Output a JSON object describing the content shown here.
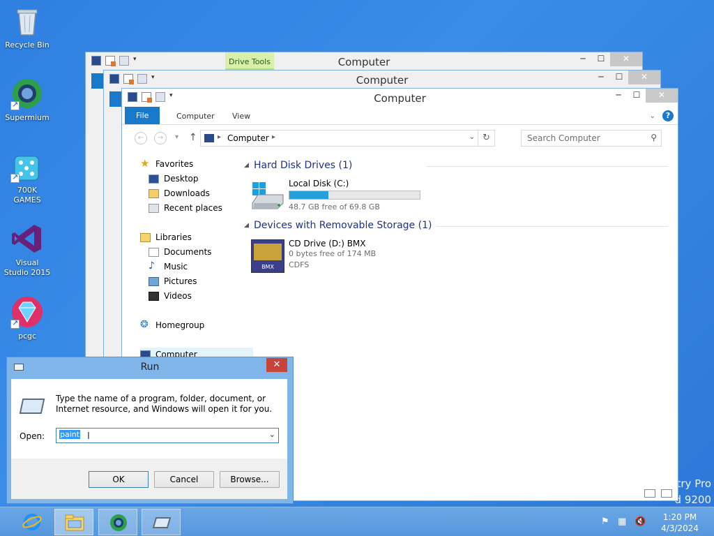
{
  "desktop": {
    "icons": [
      {
        "label": "Recycle Bin"
      },
      {
        "label": "Supermium"
      },
      {
        "label": "700K GAMES"
      },
      {
        "label": "Visual Studio 2015"
      },
      {
        "label": "pcgc"
      }
    ],
    "watermark_line1": "stry Pro",
    "watermark_line2": "d 9200"
  },
  "windows": {
    "back1": {
      "title": "Computer",
      "context_tab": "Drive Tools"
    },
    "back2": {
      "title": "Computer"
    },
    "front": {
      "title": "Computer",
      "ribbon_tabs": [
        "File",
        "Computer",
        "View"
      ],
      "address": "Computer",
      "search_placeholder": "Search Computer",
      "nav": {
        "favorites": "Favorites",
        "desktop": "Desktop",
        "downloads": "Downloads",
        "recent": "Recent places",
        "libraries": "Libraries",
        "documents": "Documents",
        "music": "Music",
        "pictures": "Pictures",
        "videos": "Videos",
        "homegroup": "Homegroup",
        "computer": "Computer"
      },
      "sections": {
        "hdd": "Hard Disk Drives (1)",
        "removable": "Devices with Removable Storage (1)"
      },
      "drives": {
        "c_name": "Local Disk (C:)",
        "c_space": "48.7 GB free of 69.8 GB",
        "c_used_fraction": 0.302,
        "d_name": "CD Drive (D:) BMX",
        "d_space": "0 bytes free of 174 MB",
        "d_fs": "CDFS"
      }
    }
  },
  "run_dialog": {
    "title": "Run",
    "close_glyph": "✕",
    "description": "Type the name of a program, folder, document, or Internet resource, and Windows will open it for you.",
    "open_label": "Open:",
    "open_value": "paint",
    "ok_label": "OK",
    "cancel_label": "Cancel",
    "browse_label": "Browse..."
  },
  "taskbar": {
    "time": "1:20 PM",
    "date": "4/3/2024"
  },
  "colors": {
    "desktop_bg": "#2f7fe0",
    "accent": "#1979ca",
    "progress_fill": "#26a0da",
    "close_red": "#c7443a"
  }
}
